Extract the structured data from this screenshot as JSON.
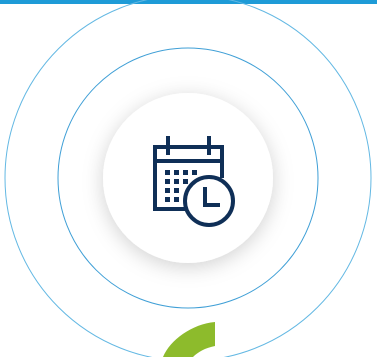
{
  "illustration": {
    "icon": "calendar-clock-icon",
    "secondary_icon": "green-arc-shape"
  },
  "colors": {
    "top_bar": "#1e9bd7",
    "outer_ring": "#63b8e3",
    "inner_ring": "#3f9fd6",
    "disc_fill": "#ffffff",
    "icon_stroke": "#0f2f57",
    "accent_green": "#8dbb2c",
    "background": "#ffffff"
  }
}
